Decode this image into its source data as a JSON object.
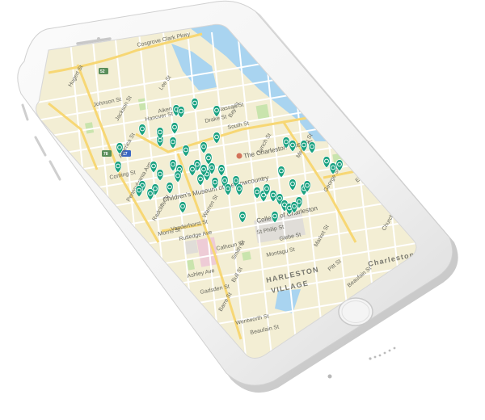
{
  "map": {
    "district_labels": [
      "HARLESTON",
      "VILLAGE"
    ],
    "area_label": "Charleston",
    "street_labels": [
      "Cosgrove Clark Pkwy",
      "Hugert St",
      "Lee St",
      "Aiken St",
      "Hanover St",
      "Jackson St",
      "Johnson St",
      "America St",
      "Drake St",
      "Nassau St",
      "Bay St",
      "South St",
      "Coming St",
      "Pennsylvania Ave",
      "Morris St",
      "Radcliffe St",
      "Vanderhorst St",
      "Warren St",
      "Calhoun St",
      "Montagu St",
      "Smith St",
      "Bull St",
      "Rutledge Ave",
      "Ashley Ave",
      "Gadsden St",
      "Barre St",
      "Wentworth St",
      "Beaufain St",
      "Meeting St",
      "St Philip St",
      "Glebe St",
      "Market St",
      "George St",
      "E Bay St",
      "Church St",
      "Pitt St",
      "Lynch St",
      "Beaufain St"
    ],
    "poi_labels": [
      "The Charleston Museum",
      "Children's Museum of the Lowcountry",
      "College of Charleston"
    ],
    "route_badges": [
      "52",
      "78",
      "17"
    ],
    "marker_color": "#1aa281",
    "marker_count": 60
  },
  "device": {
    "model": "iPhone",
    "color": "white"
  }
}
